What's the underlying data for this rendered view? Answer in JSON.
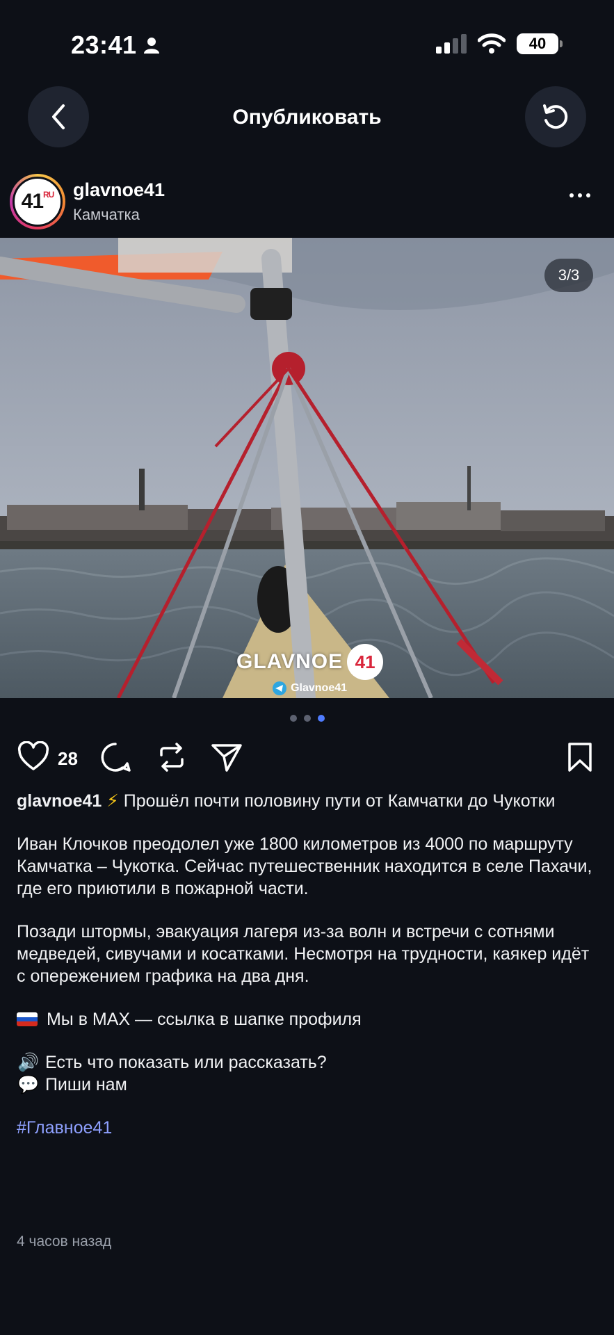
{
  "status": {
    "time": "23:41",
    "battery": "40"
  },
  "nav": {
    "title": "Опубликовать"
  },
  "profile": {
    "username": "glavnoe41",
    "location": "Камчатка",
    "avatar_text": "41",
    "avatar_suffix": "RU"
  },
  "media": {
    "counter": "3/3",
    "watermark_brand": "GLAVNOE",
    "watermark_badge": "41",
    "watermark_channel": "Glavnoe41"
  },
  "actions": {
    "likes": "28"
  },
  "caption": {
    "author": "glavnoe41",
    "headline_emoji": "⚡",
    "headline": "Прошёл почти половину пути от Камчатки до Чукотки",
    "p1": "Иван Клочков преодолел уже 1800 километров из 4000 по маршруту Камчатка – Чукотка. Сейчас путешественник находится в селе Пахачи, где его приютили в пожарной части.",
    "p2": "Позади штормы, эвакуация лагеря из-за волн и встречи с сотнями медведей, сивучами и косатками. Несмотря на трудности, каякер идёт с опережением графика на два дня.",
    "p3": "Мы в MAX — ссылка в шапке профиля",
    "p4a_emoji": "🔊",
    "p4a": "Есть что показать или рассказать?",
    "p4b_emoji": "💬",
    "p4b": "Пиши нам",
    "hashtag": "#Главное41",
    "time_ago": "4 часов назад"
  },
  "colors": {
    "background": "#0d1017",
    "accent": "#4f7cff",
    "hashtag": "#8ea0ff"
  }
}
